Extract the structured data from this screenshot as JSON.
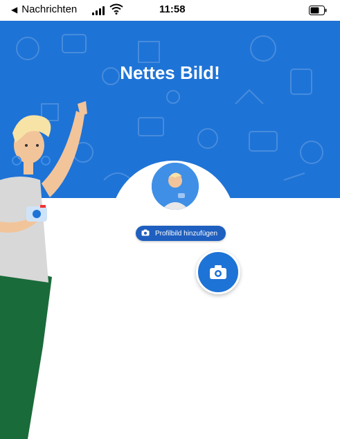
{
  "status_bar": {
    "back_label": "Nachrichten",
    "time": "11:58"
  },
  "hero": {
    "title": "Nettes Bild!",
    "background_color": "#1e73d6"
  },
  "profile": {
    "add_photo_label": "Profilbild hinzufügen"
  },
  "icons": {
    "back": "back-arrow-icon",
    "signal": "signal-icon",
    "wifi": "wifi-icon",
    "battery": "battery-icon",
    "camera": "camera-icon"
  }
}
